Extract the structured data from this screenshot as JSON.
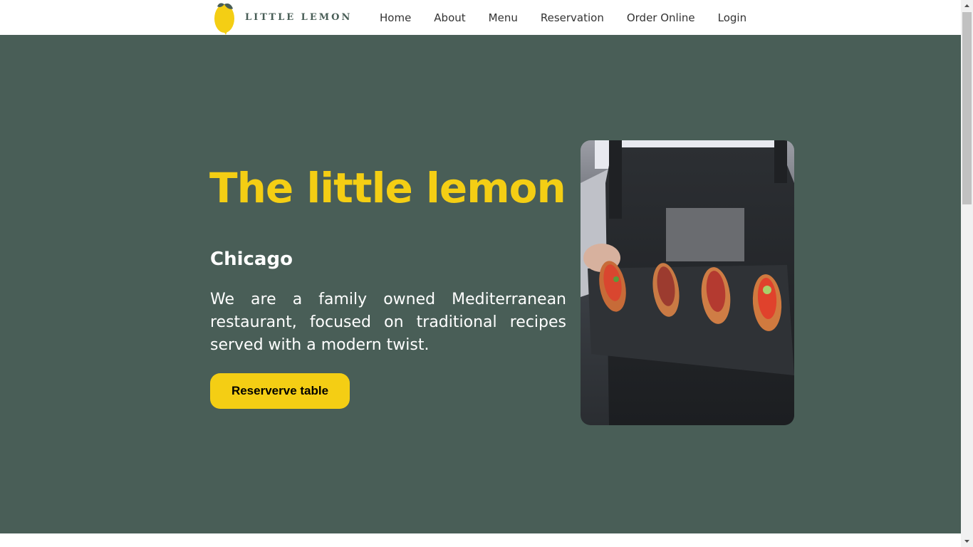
{
  "colors": {
    "primary_green": "#495e57",
    "primary_yellow": "#f4ce14",
    "white": "#ffffff"
  },
  "header": {
    "logo_text": "LITTLE LEMON",
    "nav": [
      {
        "label": "Home"
      },
      {
        "label": "About"
      },
      {
        "label": "Menu"
      },
      {
        "label": "Reservation"
      },
      {
        "label": "Order Online"
      },
      {
        "label": "Login"
      }
    ]
  },
  "hero": {
    "title": "The little lemon",
    "city": "Chicago",
    "description": "We are a family owned Mediterranean restaurant, focused on traditional recipes served with a modern twist.",
    "button_label": "Reserverve table"
  }
}
